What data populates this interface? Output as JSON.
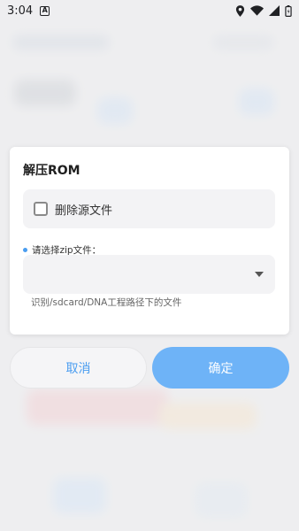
{
  "status_bar": {
    "time": "3:04",
    "notification_icon": "a-letter-icon",
    "right_icons": [
      "location-icon",
      "wifi-icon",
      "signal-icon",
      "battery-icon"
    ]
  },
  "dialog": {
    "title": "解压ROM",
    "delete_source_label": "删除源文件",
    "delete_source_checked": false,
    "zip_label": "请选择zip文件：",
    "zip_selected_value": "",
    "hint": "识别/sdcard/DNA工程路径下的文件"
  },
  "buttons": {
    "cancel_label": "取消",
    "confirm_label": "确定"
  },
  "colors": {
    "accent": "#4a9df0",
    "confirm_bg": "#6eb3f7",
    "field_bg": "#f3f3f5"
  }
}
